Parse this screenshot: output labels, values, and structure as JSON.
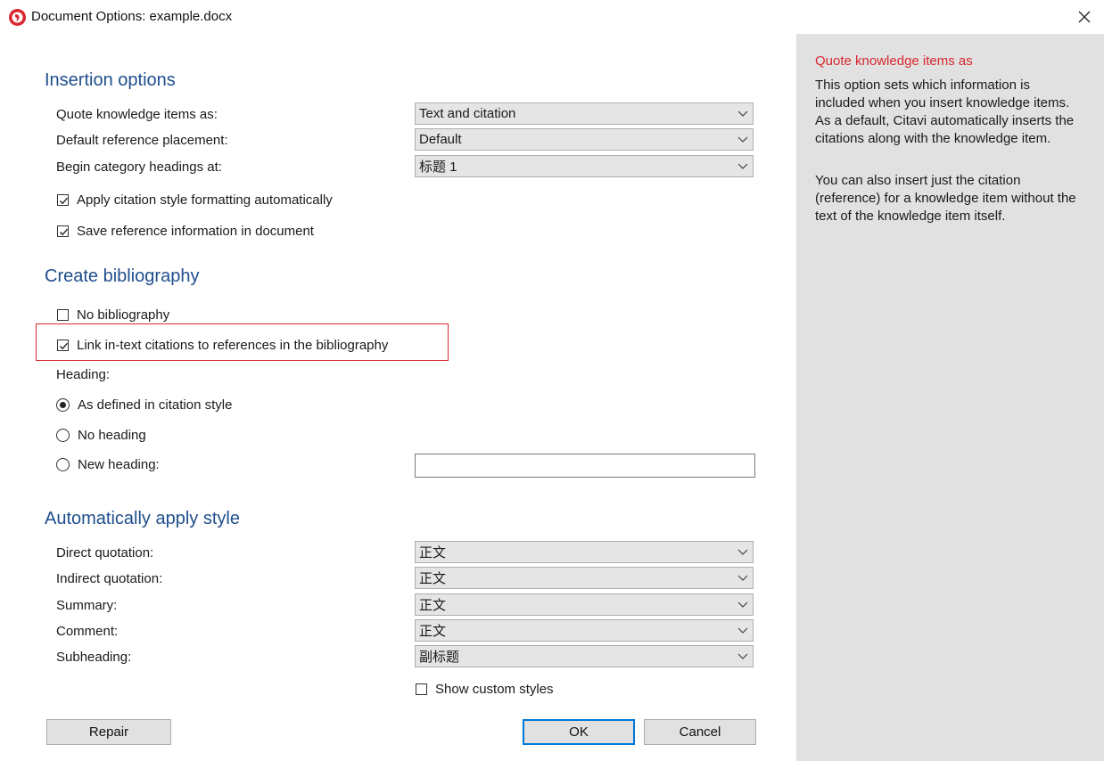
{
  "window": {
    "title": "Document Options: example.docx"
  },
  "insertion": {
    "title": "Insertion options",
    "rows": [
      {
        "label": "Quote knowledge items as:",
        "value": "Text and citation"
      },
      {
        "label": "Default reference placement:",
        "value": "Default"
      },
      {
        "label": "Begin category headings at:",
        "value": "标题 1"
      }
    ],
    "checks": [
      {
        "label": "Apply citation style formatting automatically",
        "checked": true
      },
      {
        "label": "Save reference information in document",
        "checked": true
      }
    ]
  },
  "bibliography": {
    "title": "Create bibliography",
    "no_bibliography": {
      "label": "No bibliography",
      "checked": false
    },
    "link_citations": {
      "label": "Link in-text citations to references in the bibliography",
      "checked": true
    },
    "heading_label": "Heading:",
    "radios": [
      {
        "label": "As defined in citation style",
        "selected": true
      },
      {
        "label": "No heading",
        "selected": false
      },
      {
        "label": "New heading:",
        "selected": false
      }
    ],
    "new_heading_value": ""
  },
  "styles": {
    "title": "Automatically apply style",
    "rows": [
      {
        "label": "Direct quotation:",
        "value": "正文"
      },
      {
        "label": "Indirect quotation:",
        "value": "正文"
      },
      {
        "label": "Summary:",
        "value": "正文"
      },
      {
        "label": "Comment:",
        "value": "正文"
      },
      {
        "label": "Subheading:",
        "value": "副标题"
      }
    ],
    "show_custom": {
      "label": "Show custom styles",
      "checked": false
    }
  },
  "buttons": {
    "repair": "Repair",
    "ok": "OK",
    "cancel": "Cancel"
  },
  "help": {
    "title": "Quote knowledge items as",
    "paragraph1": "This option sets which information is included when you insert knowledge items. As a default, Citavi automatically inserts the citations along with the knowledge item.",
    "paragraph2": "You can also insert just the citation (reference) for a knowledge item without the text of the knowledge item itself."
  },
  "colors": {
    "accent": "#1f4e8c",
    "help_title": "#d9272e",
    "highlight": "#d9272e",
    "side_panel": "#e1e1e1"
  },
  "icons": [
    "citavi-app-icon",
    "close-icon",
    "chevron-down-icon",
    "checkmark-icon"
  ]
}
